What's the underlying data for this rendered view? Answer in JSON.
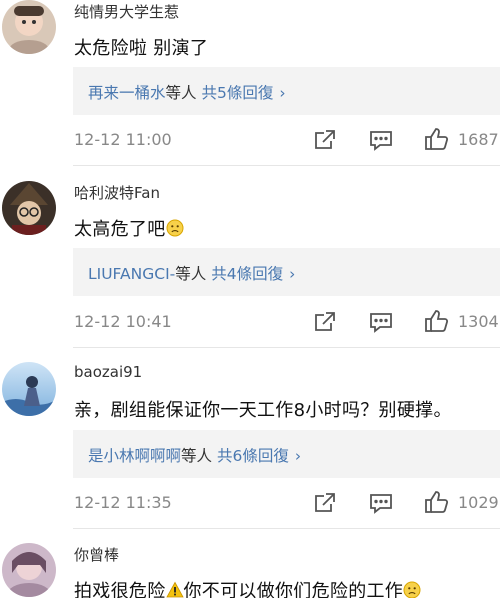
{
  "comments": [
    {
      "username": "纯情男大学生惹",
      "content": "太危险啦 别演了",
      "reply_name": "再来一桶水",
      "reply_mid": "等人",
      "reply_count": "共5條回復",
      "time": "12-12 11:00",
      "likes": "1687",
      "avatar_icon": "avatar-photo"
    },
    {
      "username": "哈利波特Fan",
      "content": "太高危了吧",
      "reply_name": "LIUFANGCI-",
      "reply_mid": "等人",
      "reply_count": "共4條回復",
      "time": "12-12 10:41",
      "likes": "1304",
      "avatar_icon": "avatar-photo",
      "emoji": "slightly-frowning-face"
    },
    {
      "username": "baozai91",
      "content": "亲，剧组能保证你一天工作8小时吗？别硬撑。",
      "reply_name": "是小林啊啊啊",
      "reply_mid": "等人",
      "reply_count": "共6條回復",
      "time": "12-12 11:35",
      "likes": "1029",
      "avatar_icon": "avatar-photo"
    },
    {
      "username": "你曾棒",
      "content_a": "拍戏很危险",
      "content_b": "你不可以做你们危险的工作",
      "avatar_icon": "avatar-photo",
      "emoji_a": "warning-sign",
      "emoji_b": "slightly-frowning-face"
    }
  ],
  "icons": [
    "share-icon",
    "comment-icon",
    "like-icon",
    "chevron-right-icon"
  ],
  "colors": {
    "link": "#4a78b0",
    "reply_bg": "#f3f3f3",
    "meta": "#888888"
  }
}
